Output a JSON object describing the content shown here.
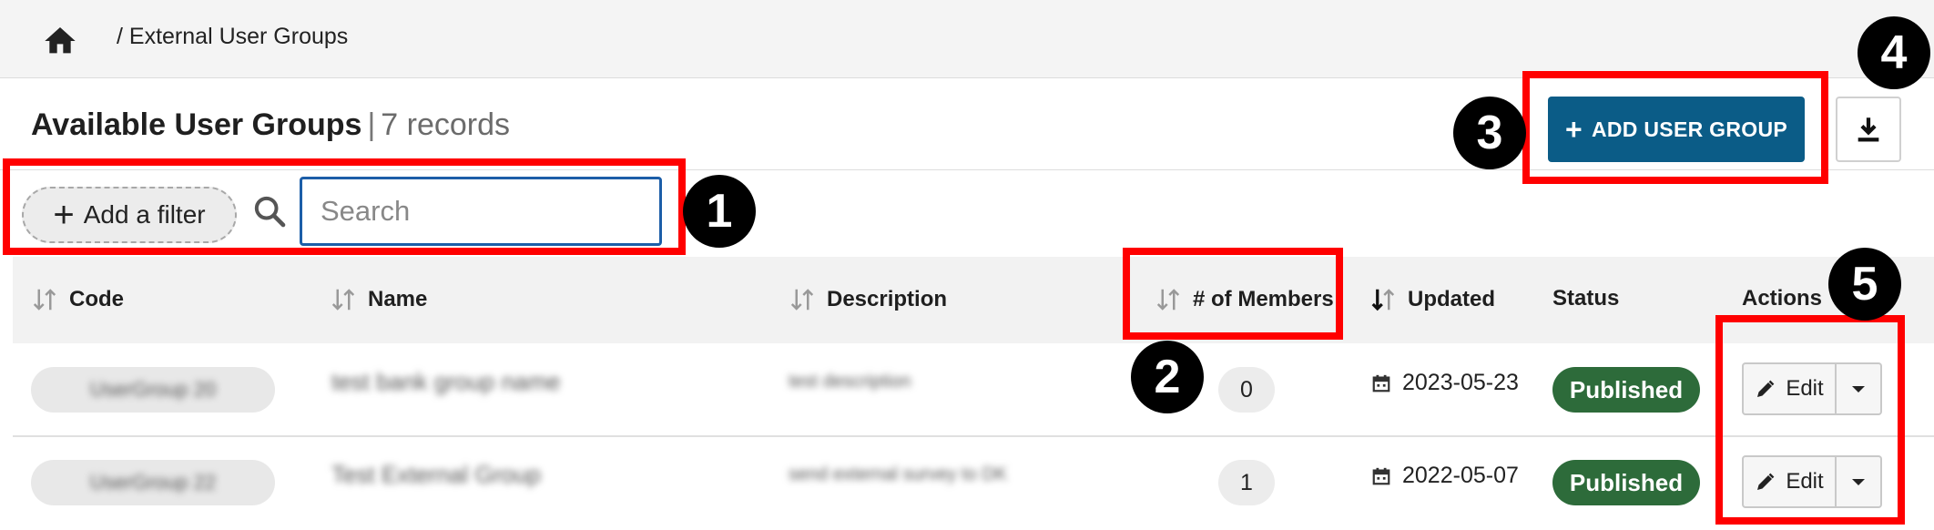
{
  "breadcrumb": {
    "home_icon": "home-icon",
    "separator": "/",
    "current": "External User Groups"
  },
  "header": {
    "title": "Available User Groups",
    "separator": "|",
    "records": "7 records"
  },
  "filters": {
    "add_filter_label": "Add a filter",
    "search_placeholder": "Search",
    "search_value": ""
  },
  "toolbar": {
    "add_label": "ADD USER GROUP",
    "download_icon": "download-icon",
    "accent": "#0b5c87"
  },
  "table": {
    "columns": [
      "Code",
      "Name",
      "Description",
      "# of Members",
      "Updated",
      "Status",
      "Actions"
    ],
    "rows": [
      {
        "code": "UserGroup 20",
        "name": "test bank group name",
        "description": "test description",
        "members": "0",
        "updated": "2023-05-23",
        "status": "Published",
        "edit_label": "Edit"
      },
      {
        "code": "UserGroup 22",
        "name": "Test External Group",
        "description": "send external survey to DK",
        "members": "1",
        "updated": "2022-05-07",
        "status": "Published",
        "edit_label": "Edit"
      }
    ]
  },
  "annotations": [
    "1",
    "2",
    "3",
    "4",
    "5"
  ],
  "colors": {
    "annotation_box": "#ff0000",
    "status_published": "#2d6b3a",
    "search_border": "#1c5ea8"
  }
}
